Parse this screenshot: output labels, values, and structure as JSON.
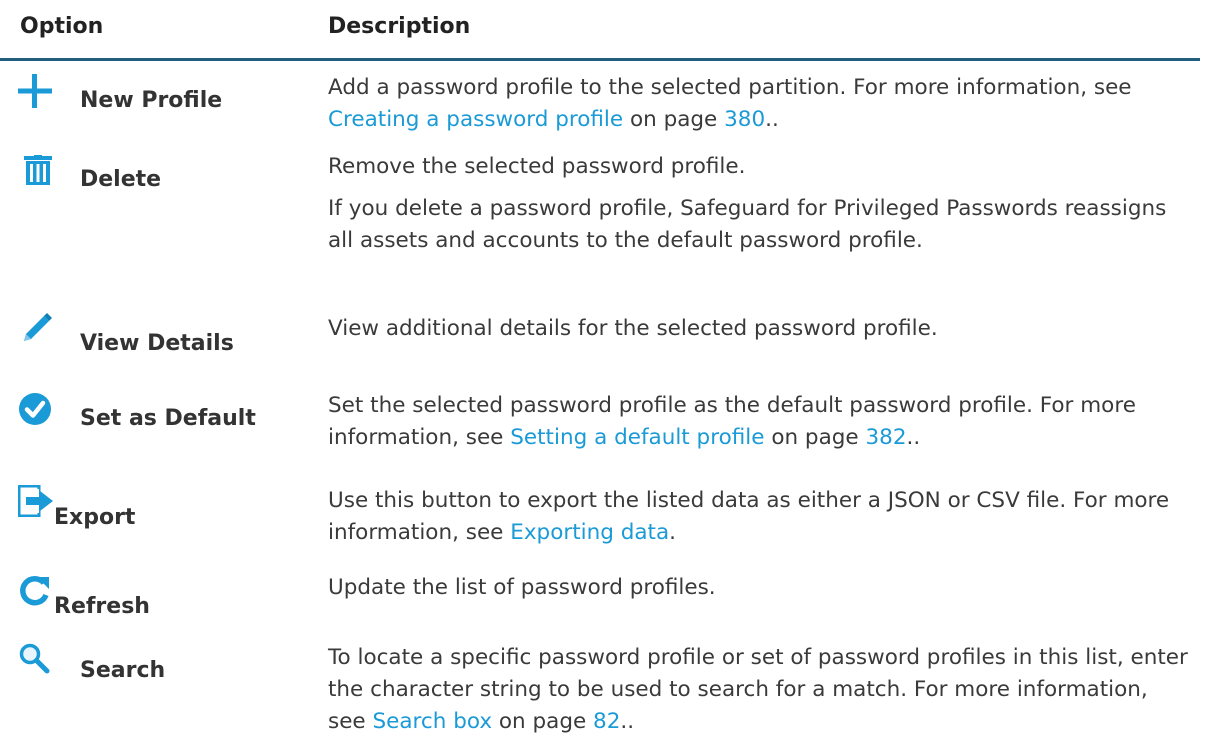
{
  "table": {
    "header_option": "Option",
    "header_description": "Description",
    "rows": [
      {
        "label": "New Profile",
        "icon": "plus-icon",
        "desc_pre": "Add a password profile to the selected partition. For more information, see ",
        "link_text": "Creating a password profile",
        "desc_mid": " on page ",
        "page_link": "380",
        "desc_post": ".."
      },
      {
        "label": "Delete",
        "icon": "trash-icon",
        "desc": "Remove the selected password profile.",
        "desc2": "If you delete a password profile, Safeguard for Privileged Passwords reassigns all assets and accounts to the default password profile."
      },
      {
        "label": "View Details",
        "icon": "pencil-icon",
        "desc": "View additional details for the selected password profile."
      },
      {
        "label": "Set as Default",
        "icon": "check-circle-icon",
        "desc_pre": "Set the selected password profile as the default password profile. For more information, see ",
        "link_text": "Setting a default profile",
        "desc_mid": " on page ",
        "page_link": "382",
        "desc_post": ".."
      },
      {
        "label": "Export",
        "icon": "export-icon",
        "desc_pre": "Use this button to export the listed data as either a JSON or CSV file. For more information, see ",
        "link_text": "Exporting data",
        "desc_post": "."
      },
      {
        "label": "Refresh",
        "icon": "refresh-icon",
        "desc": "Update the list of password profiles."
      },
      {
        "label": "Search",
        "icon": "search-icon",
        "desc_pre": "To locate a specific password profile or set of password profiles in this list, enter the character string to be used to search for a match. For more information, see ",
        "link_text": "Search box",
        "desc_mid": " on page ",
        "page_link": "82",
        "desc_post": ".."
      }
    ]
  },
  "colors": {
    "accent": "#1a9ad6",
    "header_rule": "#1f5f7d",
    "text": "#333333"
  }
}
